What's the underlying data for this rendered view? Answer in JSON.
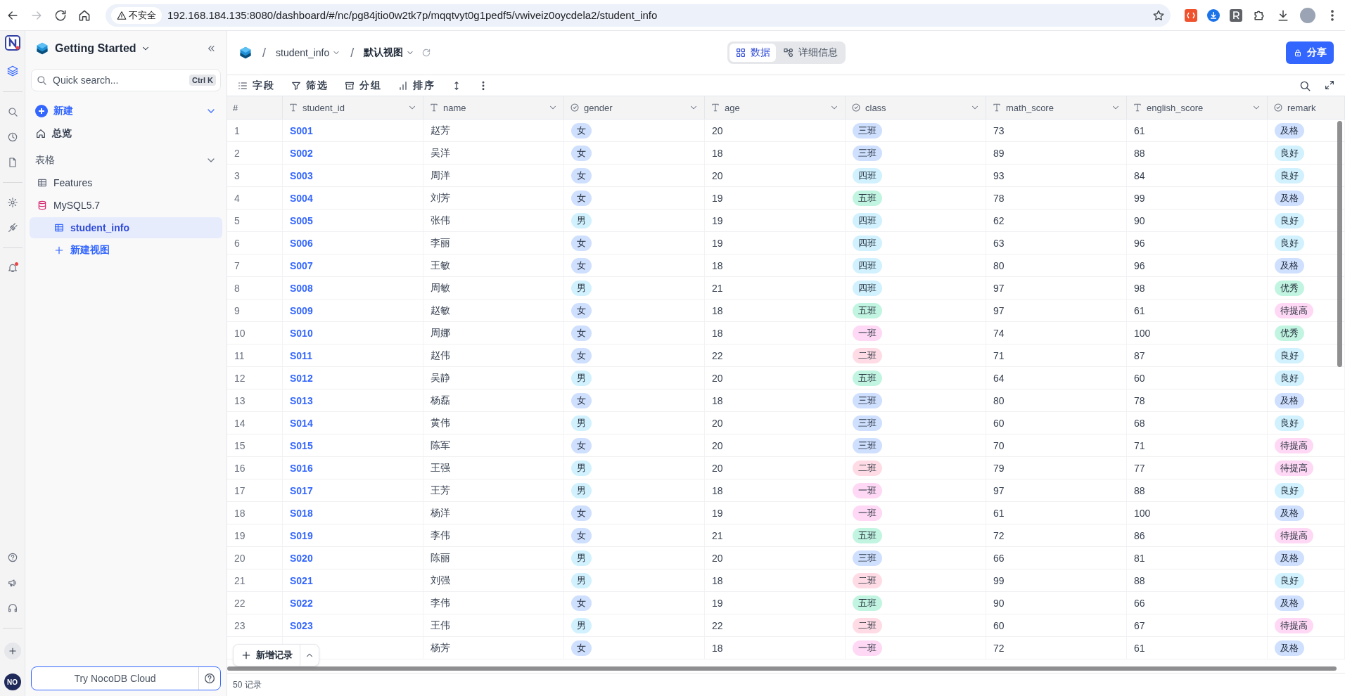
{
  "browser": {
    "security_label": "不安全",
    "url": "192.168.184.135:8080/dashboard/#/nc/pg84jtio0w2tk7p/mqqtvyt0g1pedf5/vwiveiz0oycdela2/student_info",
    "can_go_forward": false
  },
  "rail": {
    "notification_unread": true,
    "avatar": "NO"
  },
  "sidebar": {
    "workspace": "Getting Started",
    "search": {
      "placeholder": "Quick search...",
      "shortcut": "Ctrl K"
    },
    "new_label": "新建",
    "overview_label": "总览",
    "section_label": "表格",
    "items": [
      {
        "kind": "table",
        "label": "Features",
        "selected": false
      },
      {
        "kind": "database",
        "label": "MySQL5.7",
        "selected": false,
        "children": [
          {
            "kind": "table",
            "label": "student_info",
            "selected": true
          },
          {
            "kind": "add",
            "label": "新建视图",
            "selected": false
          }
        ]
      }
    ],
    "cloud_button": "Try NocoDB Cloud"
  },
  "topbar": {
    "breadcrumb_separator": "/",
    "breadcrumb": [
      "student_info",
      "默认视图"
    ],
    "view_tabs": [
      {
        "label": "数据",
        "selected": true
      },
      {
        "label": "详细信息",
        "selected": false
      }
    ],
    "share_button": "分享"
  },
  "toolbar": {
    "buttons": [
      "字段",
      "筛选",
      "分组",
      "排序"
    ]
  },
  "table": {
    "columns": [
      {
        "label": "#",
        "kind": "index"
      },
      {
        "label": "student_id",
        "kind": "text"
      },
      {
        "label": "name",
        "kind": "text"
      },
      {
        "label": "gender",
        "kind": "select"
      },
      {
        "label": "age",
        "kind": "text"
      },
      {
        "label": "class",
        "kind": "select"
      },
      {
        "label": "math_score",
        "kind": "text"
      },
      {
        "label": "english_score",
        "kind": "text"
      },
      {
        "label": "remark",
        "kind": "select"
      }
    ],
    "rows": [
      {
        "cells": [
          "1",
          "S001",
          "赵芳",
          {
            "text": "女",
            "color": "#cfdffe"
          },
          "20",
          {
            "text": "三班",
            "color": "#cfdffe"
          },
          "73",
          "61",
          {
            "text": "及格",
            "color": "#cfdffe"
          }
        ]
      },
      {
        "cells": [
          "2",
          "S002",
          "吴洋",
          {
            "text": "女",
            "color": "#cfdffe"
          },
          "18",
          {
            "text": "三班",
            "color": "#cfdffe"
          },
          "89",
          "88",
          {
            "text": "良好",
            "color": "#d0f1fd"
          }
        ]
      },
      {
        "cells": [
          "3",
          "S003",
          "周洋",
          {
            "text": "女",
            "color": "#cfdffe"
          },
          "20",
          {
            "text": "四班",
            "color": "#d0f1fd"
          },
          "93",
          "84",
          {
            "text": "良好",
            "color": "#d0f1fd"
          }
        ]
      },
      {
        "cells": [
          "4",
          "S004",
          "刘芳",
          {
            "text": "女",
            "color": "#cfdffe"
          },
          "19",
          {
            "text": "五班",
            "color": "#c2f5e1"
          },
          "78",
          "99",
          {
            "text": "及格",
            "color": "#cfdffe"
          }
        ]
      },
      {
        "cells": [
          "5",
          "S005",
          "张伟",
          {
            "text": "男",
            "color": "#d0f1fd"
          },
          "19",
          {
            "text": "四班",
            "color": "#d0f1fd"
          },
          "62",
          "90",
          {
            "text": "良好",
            "color": "#d0f1fd"
          }
        ]
      },
      {
        "cells": [
          "6",
          "S006",
          "李丽",
          {
            "text": "女",
            "color": "#cfdffe"
          },
          "19",
          {
            "text": "四班",
            "color": "#d0f1fd"
          },
          "63",
          "96",
          {
            "text": "良好",
            "color": "#d0f1fd"
          }
        ]
      },
      {
        "cells": [
          "7",
          "S007",
          "王敏",
          {
            "text": "女",
            "color": "#cfdffe"
          },
          "18",
          {
            "text": "四班",
            "color": "#d0f1fd"
          },
          "80",
          "96",
          {
            "text": "及格",
            "color": "#cfdffe"
          }
        ]
      },
      {
        "cells": [
          "8",
          "S008",
          "周敏",
          {
            "text": "男",
            "color": "#d0f1fd"
          },
          "21",
          {
            "text": "四班",
            "color": "#d0f1fd"
          },
          "97",
          "98",
          {
            "text": "优秀",
            "color": "#c2f5e1"
          }
        ]
      },
      {
        "cells": [
          "9",
          "S009",
          "赵敏",
          {
            "text": "女",
            "color": "#cfdffe"
          },
          "18",
          {
            "text": "五班",
            "color": "#c2f5e1"
          },
          "97",
          "61",
          {
            "text": "待提高",
            "color": "#fed8f4"
          }
        ]
      },
      {
        "cells": [
          "10",
          "S010",
          "周娜",
          {
            "text": "女",
            "color": "#cfdffe"
          },
          "18",
          {
            "text": "一班",
            "color": "#fed8f4"
          },
          "74",
          "100",
          {
            "text": "优秀",
            "color": "#c2f5e1"
          }
        ]
      },
      {
        "cells": [
          "11",
          "S011",
          "赵伟",
          {
            "text": "女",
            "color": "#cfdffe"
          },
          "22",
          {
            "text": "二班",
            "color": "#ffdce5"
          },
          "71",
          "87",
          {
            "text": "良好",
            "color": "#d0f1fd"
          }
        ]
      },
      {
        "cells": [
          "12",
          "S012",
          "吴静",
          {
            "text": "男",
            "color": "#d0f1fd"
          },
          "20",
          {
            "text": "五班",
            "color": "#c2f5e1"
          },
          "64",
          "60",
          {
            "text": "良好",
            "color": "#d0f1fd"
          }
        ]
      },
      {
        "cells": [
          "13",
          "S013",
          "杨磊",
          {
            "text": "女",
            "color": "#cfdffe"
          },
          "18",
          {
            "text": "三班",
            "color": "#cfdffe"
          },
          "80",
          "78",
          {
            "text": "及格",
            "color": "#cfdffe"
          }
        ]
      },
      {
        "cells": [
          "14",
          "S014",
          "黄伟",
          {
            "text": "男",
            "color": "#d0f1fd"
          },
          "20",
          {
            "text": "三班",
            "color": "#cfdffe"
          },
          "60",
          "68",
          {
            "text": "良好",
            "color": "#d0f1fd"
          }
        ]
      },
      {
        "cells": [
          "15",
          "S015",
          "陈军",
          {
            "text": "女",
            "color": "#cfdffe"
          },
          "20",
          {
            "text": "三班",
            "color": "#cfdffe"
          },
          "70",
          "71",
          {
            "text": "待提高",
            "color": "#fed8f4"
          }
        ]
      },
      {
        "cells": [
          "16",
          "S016",
          "王强",
          {
            "text": "男",
            "color": "#d0f1fd"
          },
          "20",
          {
            "text": "二班",
            "color": "#ffdce5"
          },
          "79",
          "77",
          {
            "text": "待提高",
            "color": "#fed8f4"
          }
        ]
      },
      {
        "cells": [
          "17",
          "S017",
          "王芳",
          {
            "text": "男",
            "color": "#d0f1fd"
          },
          "18",
          {
            "text": "一班",
            "color": "#fed8f4"
          },
          "97",
          "88",
          {
            "text": "良好",
            "color": "#d0f1fd"
          }
        ]
      },
      {
        "cells": [
          "18",
          "S018",
          "杨洋",
          {
            "text": "女",
            "color": "#cfdffe"
          },
          "19",
          {
            "text": "一班",
            "color": "#fed8f4"
          },
          "61",
          "100",
          {
            "text": "及格",
            "color": "#cfdffe"
          }
        ]
      },
      {
        "cells": [
          "19",
          "S019",
          "李伟",
          {
            "text": "女",
            "color": "#cfdffe"
          },
          "21",
          {
            "text": "五班",
            "color": "#c2f5e1"
          },
          "72",
          "86",
          {
            "text": "待提高",
            "color": "#fed8f4"
          }
        ]
      },
      {
        "cells": [
          "20",
          "S020",
          "陈丽",
          {
            "text": "男",
            "color": "#d0f1fd"
          },
          "20",
          {
            "text": "三班",
            "color": "#cfdffe"
          },
          "66",
          "81",
          {
            "text": "及格",
            "color": "#cfdffe"
          }
        ]
      },
      {
        "cells": [
          "21",
          "S021",
          "刘强",
          {
            "text": "男",
            "color": "#d0f1fd"
          },
          "18",
          {
            "text": "二班",
            "color": "#ffdce5"
          },
          "99",
          "88",
          {
            "text": "良好",
            "color": "#d0f1fd"
          }
        ]
      },
      {
        "cells": [
          "22",
          "S022",
          "李伟",
          {
            "text": "女",
            "color": "#cfdffe"
          },
          "19",
          {
            "text": "五班",
            "color": "#c2f5e1"
          },
          "90",
          "66",
          {
            "text": "及格",
            "color": "#cfdffe"
          }
        ]
      },
      {
        "cells": [
          "23",
          "S023",
          "王伟",
          {
            "text": "男",
            "color": "#d0f1fd"
          },
          "22",
          {
            "text": "二班",
            "color": "#ffdce5"
          },
          "60",
          "67",
          {
            "text": "待提高",
            "color": "#fed8f4"
          }
        ]
      },
      {
        "cells": [
          null,
          null,
          "杨芳",
          {
            "text": "女",
            "color": "#cfdffe"
          },
          "18",
          {
            "text": "一班",
            "color": "#fed8f4"
          },
          "72",
          "61",
          {
            "text": "及格",
            "color": "#cfdffe"
          }
        ]
      }
    ],
    "add_record_button": "新增记录",
    "record_count": "50 记录"
  }
}
